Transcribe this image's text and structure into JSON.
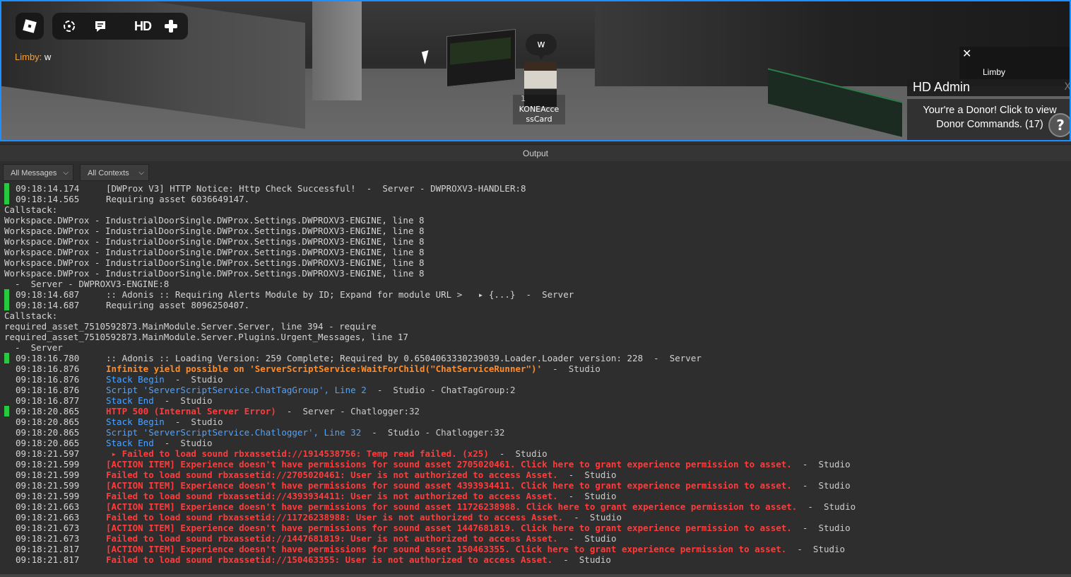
{
  "game": {
    "chat_name": "Limby:",
    "chat_message": "w",
    "speech_bubble": "w",
    "character_level": "1",
    "character_tag": "KONEAccessCard",
    "toolbar_hd": "HD",
    "icons": [
      "roblox-logo-icon",
      "capture-icon",
      "chat-icon",
      "hd-admin-icon",
      "plus-icon"
    ]
  },
  "notification": {
    "close": "✕",
    "player": "Limby"
  },
  "hd_admin": {
    "title": "HD Admin",
    "close": "X",
    "message": "Your're a Donor! Click to view Donor Commands. (17)",
    "help": "?"
  },
  "output": {
    "title": "Output",
    "message_filter": "All Messages",
    "context_filter": "All Contexts"
  },
  "log_lines": [
    {
      "marker": true,
      "ts": "09:18:14.174",
      "text": "[DWProx V3] HTTP Notice: Http Check Successful!  -  Server - DWPROXV3-HANDLER:8",
      "kind": "plain"
    },
    {
      "marker": true,
      "ts": "09:18:14.565",
      "text": "Requiring asset 6036649147.",
      "kind": "plain"
    },
    {
      "marker": false,
      "ts": "",
      "text": "Callstack:",
      "kind": "raw"
    },
    {
      "marker": false,
      "ts": "",
      "text": "Workspace.DWProx - IndustrialDoorSingle.DWProx.Settings.DWPROXV3-ENGINE, line 8",
      "kind": "raw"
    },
    {
      "marker": false,
      "ts": "",
      "text": "Workspace.DWProx - IndustrialDoorSingle.DWProx.Settings.DWPROXV3-ENGINE, line 8",
      "kind": "raw"
    },
    {
      "marker": false,
      "ts": "",
      "text": "Workspace.DWProx - IndustrialDoorSingle.DWProx.Settings.DWPROXV3-ENGINE, line 8",
      "kind": "raw"
    },
    {
      "marker": false,
      "ts": "",
      "text": "Workspace.DWProx - IndustrialDoorSingle.DWProx.Settings.DWPROXV3-ENGINE, line 8",
      "kind": "raw"
    },
    {
      "marker": false,
      "ts": "",
      "text": "Workspace.DWProx - IndustrialDoorSingle.DWProx.Settings.DWPROXV3-ENGINE, line 8",
      "kind": "raw"
    },
    {
      "marker": false,
      "ts": "",
      "text": "Workspace.DWProx - IndustrialDoorSingle.DWProx.Settings.DWPROXV3-ENGINE, line 8",
      "kind": "raw"
    },
    {
      "marker": false,
      "ts": "",
      "text": "  -  Server - DWPROXV3-ENGINE:8",
      "kind": "raw"
    },
    {
      "marker": true,
      "ts": "09:18:14.687",
      "text": ":: Adonis :: Requiring Alerts Module by ID; Expand for module URL >   ▸ {...}  -  Server",
      "kind": "plain"
    },
    {
      "marker": true,
      "ts": "09:18:14.687",
      "text": "Requiring asset 8096250407.",
      "kind": "plain"
    },
    {
      "marker": false,
      "ts": "",
      "text": "Callstack:",
      "kind": "raw"
    },
    {
      "marker": false,
      "ts": "",
      "text": "required_asset_7510592873.MainModule.Server.Server, line 394 - require",
      "kind": "raw"
    },
    {
      "marker": false,
      "ts": "",
      "text": "required_asset_7510592873.MainModule.Server.Plugins.Urgent_Messages, line 17",
      "kind": "raw"
    },
    {
      "marker": false,
      "ts": "",
      "text": "  -  Server",
      "kind": "raw"
    },
    {
      "marker": true,
      "ts": "09:18:16.780",
      "text": ":: Adonis :: Loading Version: 259 Complete; Required by 0.6504063330239039.Loader.Loader version: 228  -  Server",
      "kind": "plain"
    },
    {
      "marker": false,
      "ts": "09:18:16.876",
      "text": "Infinite yield possible on 'ServerScriptService:WaitForChild(\"ChatServiceRunner\")'",
      "ctx": "  -  Studio",
      "kind": "warn"
    },
    {
      "marker": false,
      "ts": "09:18:16.876",
      "text": "Stack Begin",
      "ctx": "  -  Studio",
      "kind": "info"
    },
    {
      "marker": false,
      "ts": "09:18:16.876",
      "text": "Script 'ServerScriptService.ChatTagGroup', Line 2",
      "ctx": "  -  Studio - ChatTagGroup:2",
      "kind": "info"
    },
    {
      "marker": false,
      "ts": "09:18:16.877",
      "text": "Stack End",
      "ctx": "  -  Studio",
      "kind": "info"
    },
    {
      "marker": true,
      "ts": "09:18:20.865",
      "text": "HTTP 500 (Internal Server Error)",
      "ctx": "  -  Server - Chatlogger:32",
      "kind": "err"
    },
    {
      "marker": false,
      "ts": "09:18:20.865",
      "text": "Stack Begin",
      "ctx": "  -  Studio",
      "kind": "info"
    },
    {
      "marker": false,
      "ts": "09:18:20.865",
      "text": "Script 'ServerScriptService.Chatlogger', Line 32",
      "ctx": "  -  Studio - Chatlogger:32",
      "kind": "info"
    },
    {
      "marker": false,
      "ts": "09:18:20.865",
      "text": "Stack End",
      "ctx": "  -  Studio",
      "kind": "info"
    },
    {
      "marker": false,
      "ts": "09:18:21.597",
      "text": " ▸ Failed to load sound rbxassetid://1914538756: Temp read failed. (x25)",
      "ctx": "  -  Studio",
      "kind": "err"
    },
    {
      "marker": false,
      "ts": "09:18:21.599",
      "text": "[ACTION ITEM] Experience doesn't have permissions for sound asset 2705020461. Click here to grant experience permission to asset.",
      "ctx": "  -  Studio",
      "kind": "err"
    },
    {
      "marker": false,
      "ts": "09:18:21.599",
      "text": "Failed to load sound rbxassetid://2705020461: User is not authorized to access Asset.",
      "ctx": "  -  Studio",
      "kind": "err"
    },
    {
      "marker": false,
      "ts": "09:18:21.599",
      "text": "[ACTION ITEM] Experience doesn't have permissions for sound asset 4393934411. Click here to grant experience permission to asset.",
      "ctx": "  -  Studio",
      "kind": "err"
    },
    {
      "marker": false,
      "ts": "09:18:21.599",
      "text": "Failed to load sound rbxassetid://4393934411: User is not authorized to access Asset.",
      "ctx": "  -  Studio",
      "kind": "err"
    },
    {
      "marker": false,
      "ts": "09:18:21.663",
      "text": "[ACTION ITEM] Experience doesn't have permissions for sound asset 11726238988. Click here to grant experience permission to asset.",
      "ctx": "  -  Studio",
      "kind": "err"
    },
    {
      "marker": false,
      "ts": "09:18:21.663",
      "text": "Failed to load sound rbxassetid://11726238988: User is not authorized to access Asset.",
      "ctx": "  -  Studio",
      "kind": "err"
    },
    {
      "marker": false,
      "ts": "09:18:21.673",
      "text": "[ACTION ITEM] Experience doesn't have permissions for sound asset 1447681819. Click here to grant experience permission to asset.",
      "ctx": "  -  Studio",
      "kind": "err"
    },
    {
      "marker": false,
      "ts": "09:18:21.673",
      "text": "Failed to load sound rbxassetid://1447681819: User is not authorized to access Asset.",
      "ctx": "  -  Studio",
      "kind": "err"
    },
    {
      "marker": false,
      "ts": "09:18:21.817",
      "text": "[ACTION ITEM] Experience doesn't have permissions for sound asset 150463355. Click here to grant experience permission to asset.",
      "ctx": "  -  Studio",
      "kind": "err"
    },
    {
      "marker": false,
      "ts": "09:18:21.817",
      "text": "Failed to load sound rbxassetid://150463355: User is not authorized to access Asset.",
      "ctx": "  -  Studio",
      "kind": "err"
    }
  ]
}
